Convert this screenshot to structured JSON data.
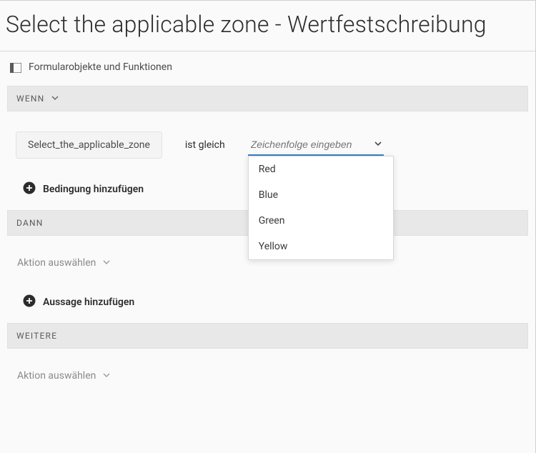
{
  "title": "Select the applicable zone - Wertfestschreibung",
  "toolbar": {
    "label": "Formularobjekte und Funktionen"
  },
  "sections": {
    "when": "WENN",
    "then": "DANN",
    "else": "WEITERE"
  },
  "rule": {
    "field_chip": "Select_the_applicable_zone",
    "operator": "ist gleich",
    "value_placeholder": "Zeichenfolge eingeben",
    "options": [
      "Red",
      "Blue",
      "Green",
      "Yellow"
    ]
  },
  "add": {
    "condition": "Bedingung hinzufügen",
    "statement": "Aussage hinzufügen"
  },
  "action_select": "Aktion auswählen"
}
